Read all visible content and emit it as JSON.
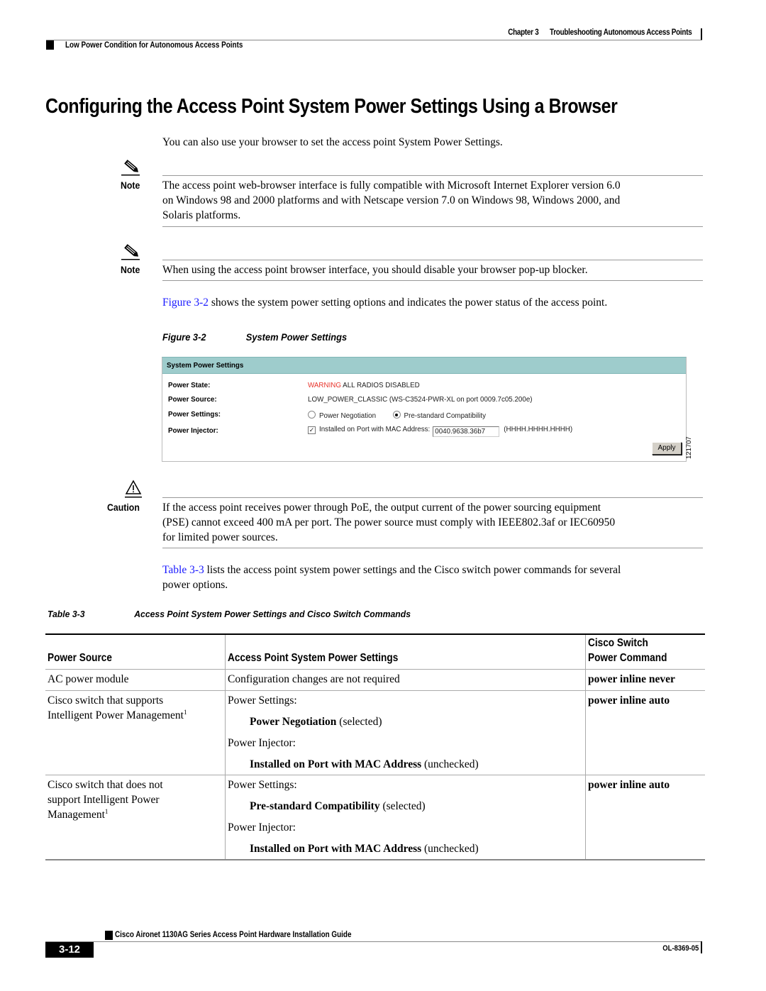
{
  "header": {
    "chapter_num": "Chapter 3",
    "chapter_title": "Troubleshooting Autonomous Access Points",
    "section": "Low Power Condition for Autonomous Access Points"
  },
  "title": "Configuring the Access Point System Power Settings Using a Browser",
  "intro": "You can also use your browser to set the access point System Power Settings.",
  "notes": [
    {
      "label": "Note",
      "icon": "pencil-icon",
      "lines": [
        "The access point web-browser interface is fully compatible with Microsoft Internet Explorer version 6.0",
        "on Windows 98 and 2000 platforms and with Netscape version 7.0 on Windows 98, Windows 2000, and",
        "Solaris platforms."
      ]
    },
    {
      "label": "Note",
      "icon": "pencil-icon",
      "lines": [
        "When using the access point browser interface, you should disable your browser pop-up blocker."
      ]
    }
  ],
  "figure_ref_para": {
    "link": "Figure 3-2",
    "text": " shows the system power setting options and indicates the power status of the access point."
  },
  "figure": {
    "number": "Figure 3-2",
    "title": "System Power Settings",
    "panel_title": "System Power Settings",
    "rows": [
      {
        "label": "Power State:"
      },
      {
        "label": "Power Source:"
      },
      {
        "label": "Power Settings:"
      },
      {
        "label": "Power Injector:"
      }
    ],
    "power_state_warning": "WARNING",
    "power_state_text": " ALL RADIOS DISABLED",
    "power_source_value": "LOW_POWER_CLASSIC (WS-C3524-PWR-XL on port 0009.7c05.200e)",
    "option_negotiation": "Power Negotiation",
    "option_prestandard": "Pre-standard Compatibility",
    "selected_option": "Pre-standard Compatibility",
    "injector_checked": true,
    "injector_label": "Installed on Port with MAC Address:",
    "mac_value": "0040.9638.36b7",
    "mac_format": "(HHHH.HHHH.HHHH)",
    "apply_label": "Apply",
    "image_id": "121707",
    "colors": {
      "header_bg": "#9ecccc",
      "warning": "#e8332a"
    }
  },
  "caution": {
    "label": "Caution",
    "icon": "warning-triangle-icon",
    "lines": [
      "If the access point receives power through PoE, the output current of the power sourcing equipment",
      "(PSE) cannot exceed 400 mA per port. The power source must comply with IEEE802.3af or IEC60950",
      "for limited power sources."
    ]
  },
  "table_ref_para": {
    "link": "Table 3-3",
    "line1": " lists the access point system power settings and the Cisco switch power commands for several",
    "line2": "power options."
  },
  "table": {
    "number": "Table 3-3",
    "title": "Access Point System Power Settings and Cisco Switch Commands",
    "headers": [
      "Power Source",
      "Access Point System Power Settings",
      "Cisco Switch",
      "Power Command"
    ],
    "rows": [
      {
        "source": [
          "AC power module"
        ],
        "settings": "Configuration changes are not required",
        "command": "power inline never"
      },
      {
        "source": [
          "Cisco switch that supports",
          "Intelligent Power Management"
        ],
        "footnote": "1",
        "settings_label1": "Power Settings:",
        "settings_bold1": "Power Negotiation",
        "settings_note1": " (selected)",
        "settings_label2": "Power Injector:",
        "settings_bold2": "Installed on Port with MAC Address",
        "settings_note2": " (unchecked)",
        "command": "power inline auto"
      },
      {
        "source": [
          "Cisco switch that does not",
          "support Intelligent Power",
          "Management"
        ],
        "footnote": "1",
        "settings_label1": "Power Settings:",
        "settings_bold1": "Pre-standard Compatibility",
        "settings_note1": " (selected)",
        "settings_label2": "Power Injector:",
        "settings_bold2": "Installed on Port with MAC Address",
        "settings_note2": " (unchecked)",
        "command": "power inline auto"
      }
    ]
  },
  "footer": {
    "guide_title": "Cisco Aironet 1130AG Series Access Point Hardware Installation Guide",
    "page": "3-12",
    "doc_id": "OL-8369-05"
  }
}
